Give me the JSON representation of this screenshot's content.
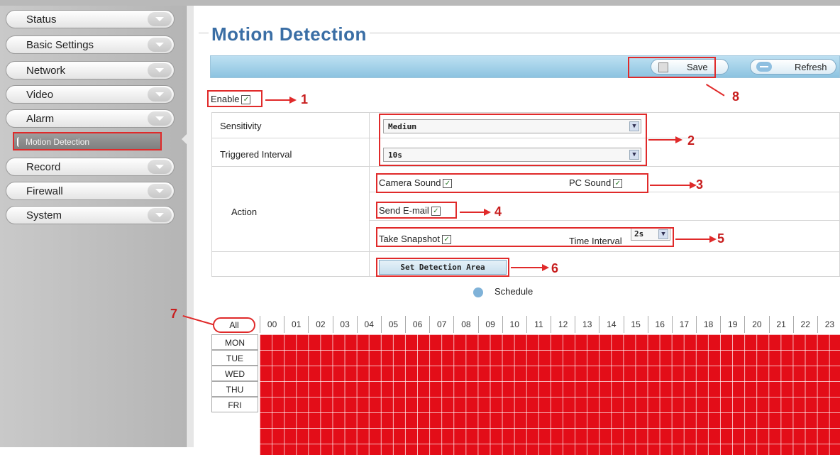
{
  "sidebar": {
    "items": [
      {
        "label": "Status"
      },
      {
        "label": "Basic Settings"
      },
      {
        "label": "Network"
      },
      {
        "label": "Video"
      },
      {
        "label": "Alarm"
      },
      {
        "label": "Record"
      },
      {
        "label": "Firewall"
      },
      {
        "label": "System"
      }
    ],
    "sub_item": {
      "label": "Motion Detection"
    }
  },
  "page": {
    "title": "Motion Detection"
  },
  "toolbar": {
    "save_label": "Save",
    "refresh_label": "Refresh"
  },
  "form": {
    "enable_label": "Enable",
    "enable_checked": true,
    "sensitivity_label": "Sensitivity",
    "sensitivity_value": "Medium",
    "triggered_interval_label": "Triggered Interval",
    "triggered_interval_value": "10s",
    "action_label": "Action",
    "camera_sound_label": "Camera Sound",
    "pc_sound_label": "PC Sound",
    "send_email_label": "Send E-mail",
    "take_snapshot_label": "Take Snapshot",
    "time_interval_label": "Time Interval",
    "time_interval_value": "2s",
    "set_detection_area_label": "Set Detection Area"
  },
  "schedule": {
    "label": "Schedule",
    "all_label": "All",
    "hours": [
      "00",
      "01",
      "02",
      "03",
      "04",
      "05",
      "06",
      "07",
      "08",
      "09",
      "10",
      "11",
      "12",
      "13",
      "14",
      "15",
      "16",
      "17",
      "18",
      "19",
      "20",
      "21",
      "22",
      "23"
    ],
    "days": [
      "MON",
      "TUE",
      "WED",
      "THU",
      "FRI"
    ]
  },
  "annotations": {
    "m1": "1",
    "m2": "2",
    "m3": "3",
    "m4": "4",
    "m5": "5",
    "m6": "6",
    "m7": "7",
    "m8": "8"
  },
  "colors": {
    "annotation_red": "#e02a2a",
    "schedule_red": "#e30d18",
    "title_blue": "#3a6ea5",
    "toolbar_blue": "#8cc3e0"
  }
}
